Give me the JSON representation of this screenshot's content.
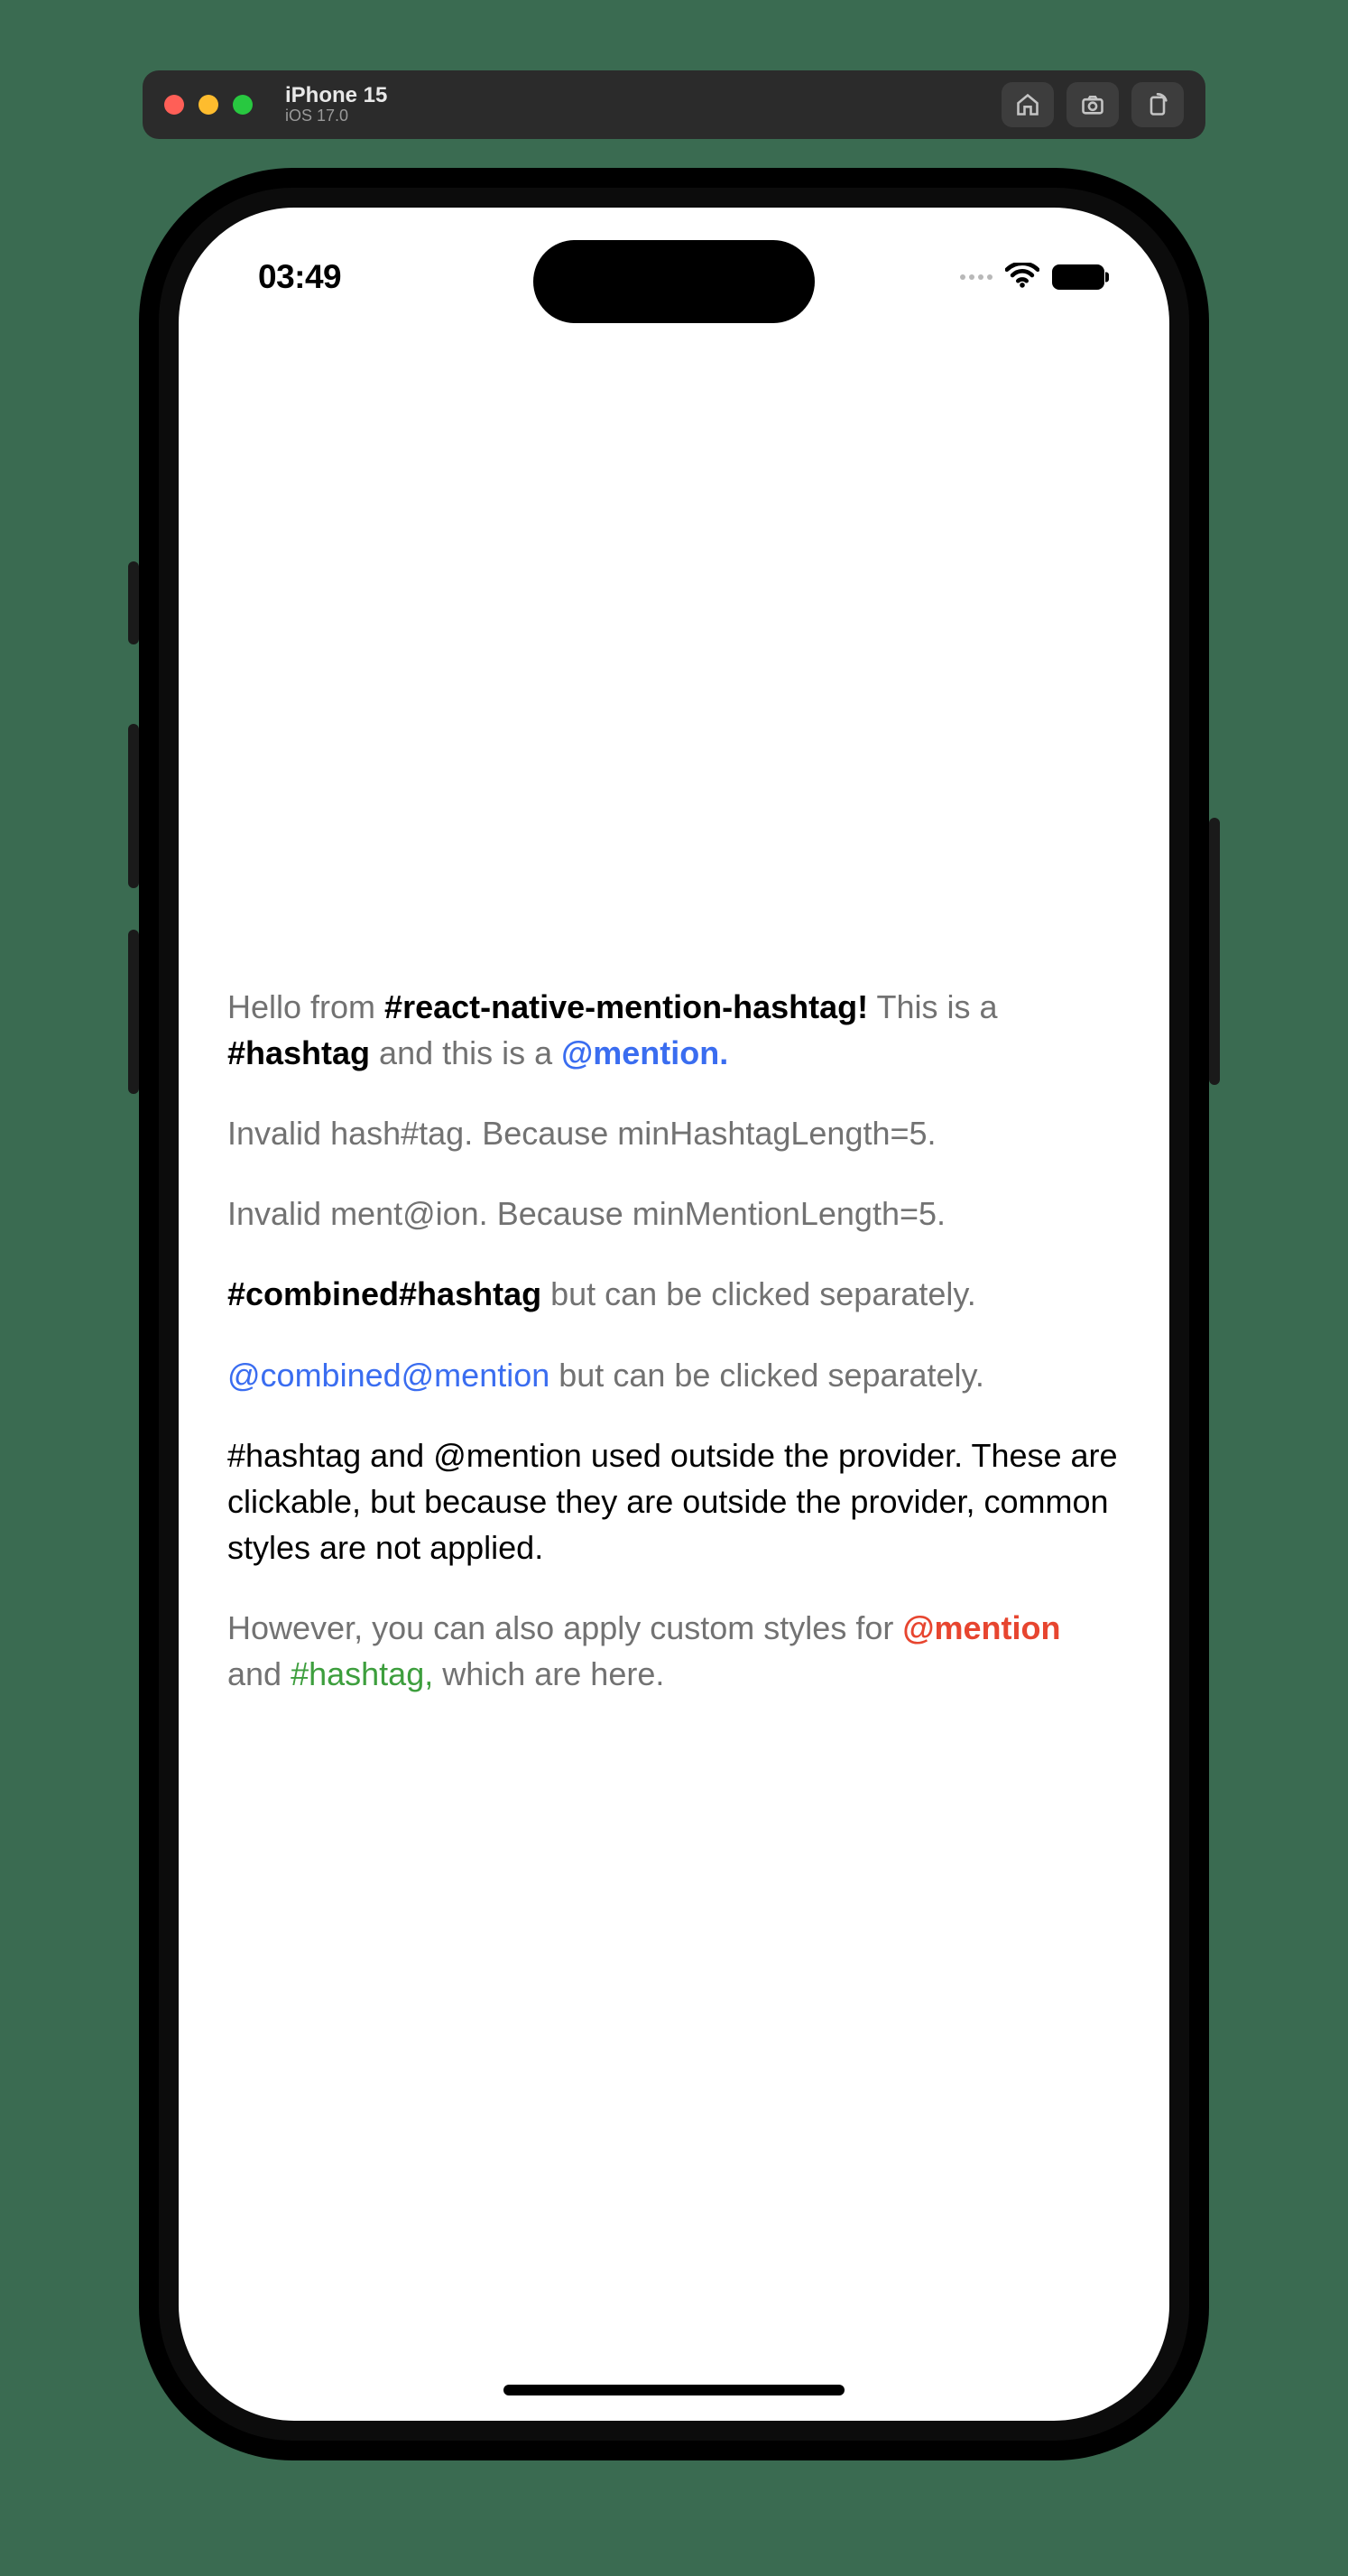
{
  "sim": {
    "device": "iPhone 15",
    "os": "iOS 17.0"
  },
  "status": {
    "time": "03:49"
  },
  "content": {
    "p1": {
      "t1": "Hello from ",
      "hashtag1": "#react-native-mention-hashtag!",
      "t2": " This is a ",
      "hashtag2": "#hashtag",
      "t3": " and this is a ",
      "mention1": "@mention."
    },
    "p2": "Invalid hash#tag. Because minHashtagLength=5.",
    "p3": "Invalid ment@ion. Because minMentionLength=5.",
    "p4": {
      "hashtag": "#combined#hashtag",
      "rest": " but can be clicked separately."
    },
    "p5": {
      "mention": "@combined@mention",
      "rest": " but can be clicked separately."
    },
    "p6": "#hashtag and @mention used outside the provider. These are clickable, but because they are outside the provider, common styles are not applied.",
    "p7": {
      "t1": "However, you can also apply custom styles for ",
      "mention": "@mention",
      "t2": " and ",
      "hashtag": "#hashtag,",
      "t3": " which are here."
    }
  }
}
